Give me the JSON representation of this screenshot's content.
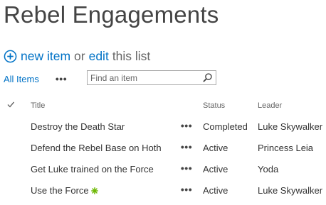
{
  "page": {
    "title": "Rebel Engagements"
  },
  "command_line": {
    "add_icon": "circle-plus-icon",
    "new_item": "new item",
    "or": "or",
    "edit": "edit",
    "this_list": "this list"
  },
  "view_bar": {
    "view_name": "All Items",
    "more_label": "•••",
    "search_placeholder": "Find an item",
    "search_value": "",
    "search_icon": "magnifier-icon"
  },
  "list": {
    "columns": {
      "title": "Title",
      "status": "Status",
      "leader": "Leader"
    },
    "row_menu_label": "•••",
    "rows": [
      {
        "title": "Destroy the Death Star",
        "status": "Completed",
        "leader": "Luke Skywalker",
        "is_new": false
      },
      {
        "title": "Defend the Rebel Base on Hoth",
        "status": "Active",
        "leader": "Princess Leia",
        "is_new": false
      },
      {
        "title": "Get Luke trained on the Force",
        "status": "Active",
        "leader": "Yoda",
        "is_new": false
      },
      {
        "title": "Use the Force",
        "status": "Active",
        "leader": "Luke Skywalker",
        "is_new": true
      }
    ]
  },
  "colors": {
    "link": "#0072c6",
    "new_badge": "#6bb700",
    "title_text": "#444444"
  }
}
